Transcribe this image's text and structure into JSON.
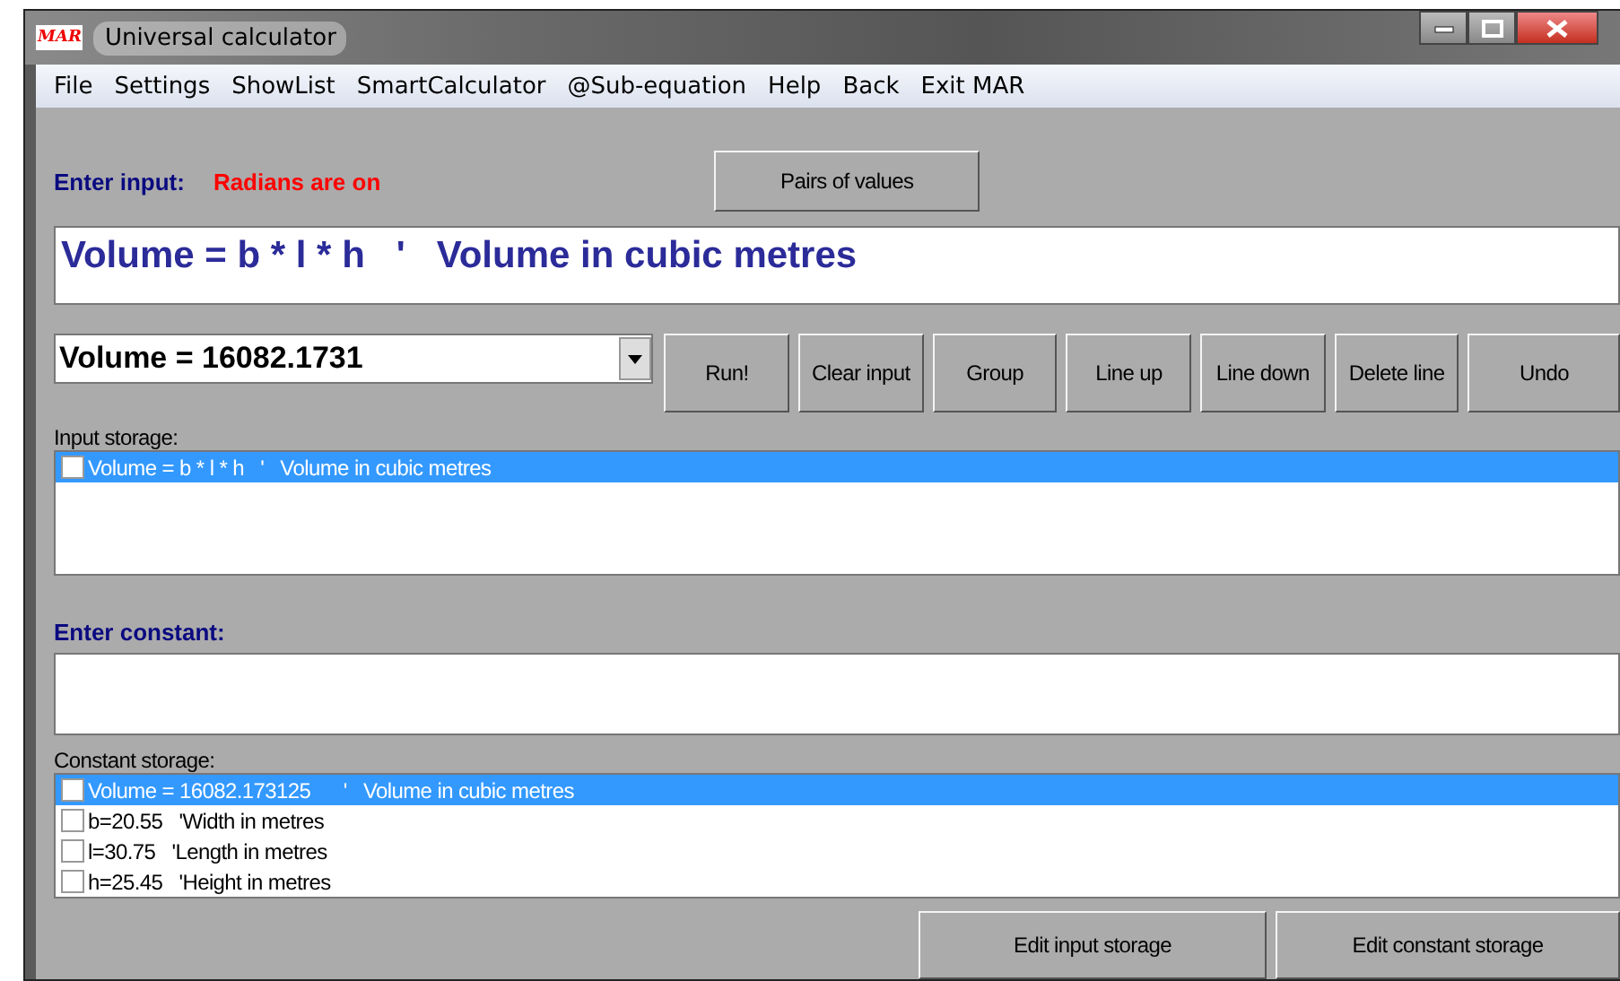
{
  "window": {
    "title": "Universal calculator",
    "logo": "MAR"
  },
  "menu": [
    "File",
    "Settings",
    "ShowList",
    "SmartCalculator",
    "@Sub-equation",
    "Help",
    "Back",
    "Exit MAR"
  ],
  "input_label": "Enter input:",
  "radians_status": "Radians are on",
  "pairs_button": "Pairs of values",
  "input_field": {
    "value": "Volume = b * l * h   '   Volume in cubic metres"
  },
  "result_combo": {
    "value": "Volume = 16082.1731"
  },
  "buttons": [
    "Run!",
    "Clear input",
    "Group",
    "Line up",
    "Line down",
    "Delete line",
    "Undo"
  ],
  "input_storage": {
    "label": "Input storage:",
    "items": [
      {
        "text": "Volume = b * l * h   '   Volume in cubic metres",
        "selected": true,
        "checked": false
      }
    ]
  },
  "constant_label": "Enter constant:",
  "constant_storage": {
    "label": "Constant storage:",
    "items": [
      {
        "text": "Volume = 16082.173125      '   Volume in cubic metres",
        "selected": true,
        "checked": false
      },
      {
        "text": "b=20.55   'Width in metres",
        "selected": false,
        "checked": false
      },
      {
        "text": "l=30.75   'Length in metres",
        "selected": false,
        "checked": false
      },
      {
        "text": "h=25.45   'Height in metres",
        "selected": false,
        "checked": false
      }
    ]
  },
  "bottom_buttons": [
    "Edit input storage",
    "Edit constant storage"
  ]
}
